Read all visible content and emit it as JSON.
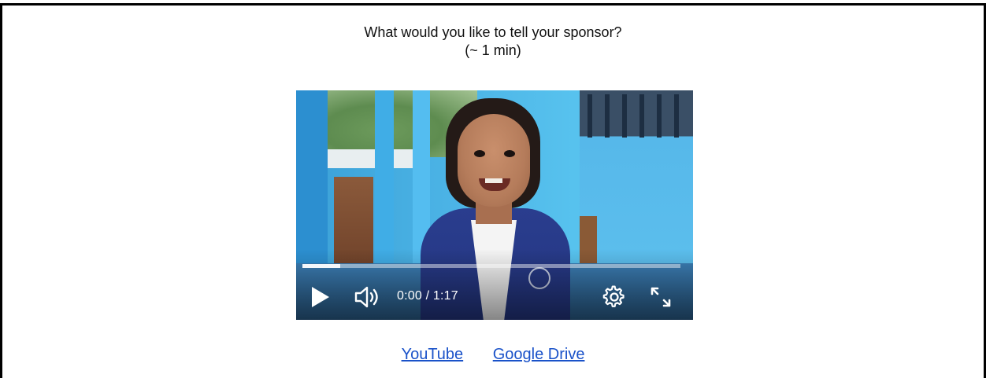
{
  "prompt": {
    "line1": "What would you like to tell your sponsor?",
    "line2": "(~ 1 min)"
  },
  "video": {
    "time_display": "0:00 / 1:17",
    "progress_fraction": 0.1,
    "controls": {
      "play": "play-icon",
      "volume": "volume-icon",
      "settings": "gear-icon",
      "fullscreen": "fullscreen-icon"
    }
  },
  "links": [
    {
      "label": "YouTube"
    },
    {
      "label": "Google Drive"
    }
  ],
  "colors": {
    "link": "#1a52c9",
    "frame": "#000000"
  }
}
